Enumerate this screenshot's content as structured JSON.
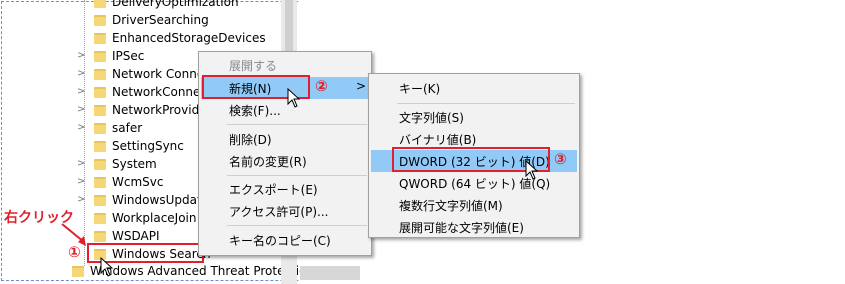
{
  "tree": {
    "items": [
      {
        "label": "DeliveryOptimization",
        "chevron": false
      },
      {
        "label": "DriverSearching",
        "chevron": false
      },
      {
        "label": "EnhancedStorageDevices",
        "chevron": false
      },
      {
        "label": "IPSec",
        "chevron": true
      },
      {
        "label": "Network Connec",
        "chevron": true
      },
      {
        "label": "NetworkConnec",
        "chevron": true
      },
      {
        "label": "NetworkProvide",
        "chevron": true
      },
      {
        "label": "safer",
        "chevron": true
      },
      {
        "label": "SettingSync",
        "chevron": false
      },
      {
        "label": "System",
        "chevron": true
      },
      {
        "label": "WcmSvc",
        "chevron": true
      },
      {
        "label": "WindowsUpdate",
        "chevron": true
      },
      {
        "label": "WorkplaceJoin",
        "chevron": false
      },
      {
        "label": "WSDAPI",
        "chevron": false
      },
      {
        "label": "Windows Search",
        "chevron": false
      },
      {
        "label": "Windows Advanced Threat Protection",
        "chevron": false
      }
    ]
  },
  "context_menu": {
    "items": [
      {
        "label": "展開する",
        "disabled": true
      },
      {
        "label": "新規(N)",
        "submenu_arrow": ">",
        "highlighted": true
      },
      {
        "label": "検索(F)..."
      },
      {
        "label": "削除(D)"
      },
      {
        "label": "名前の変更(R)"
      },
      {
        "label": "エクスポート(E)"
      },
      {
        "label": "アクセス許可(P)..."
      },
      {
        "label": "キー名のコピー(C)"
      }
    ]
  },
  "submenu": {
    "items": [
      {
        "label": "キー(K)"
      },
      {
        "label": "文字列値(S)"
      },
      {
        "label": "バイナリ値(B)"
      },
      {
        "label": "DWORD (32 ビット) 値(D)",
        "highlighted": true
      },
      {
        "label": "QWORD (64 ビット) 値(Q)"
      },
      {
        "label": "複数行文字列値(M)"
      },
      {
        "label": "展開可能な文字列値(E)"
      }
    ]
  },
  "annotations": {
    "right_click": "右クリック",
    "step1": "①",
    "step2": "②",
    "step3": "③"
  },
  "colors": {
    "highlight": "#91c9f7",
    "annotation_red": "#e0202c",
    "folder": "#f5d777"
  }
}
